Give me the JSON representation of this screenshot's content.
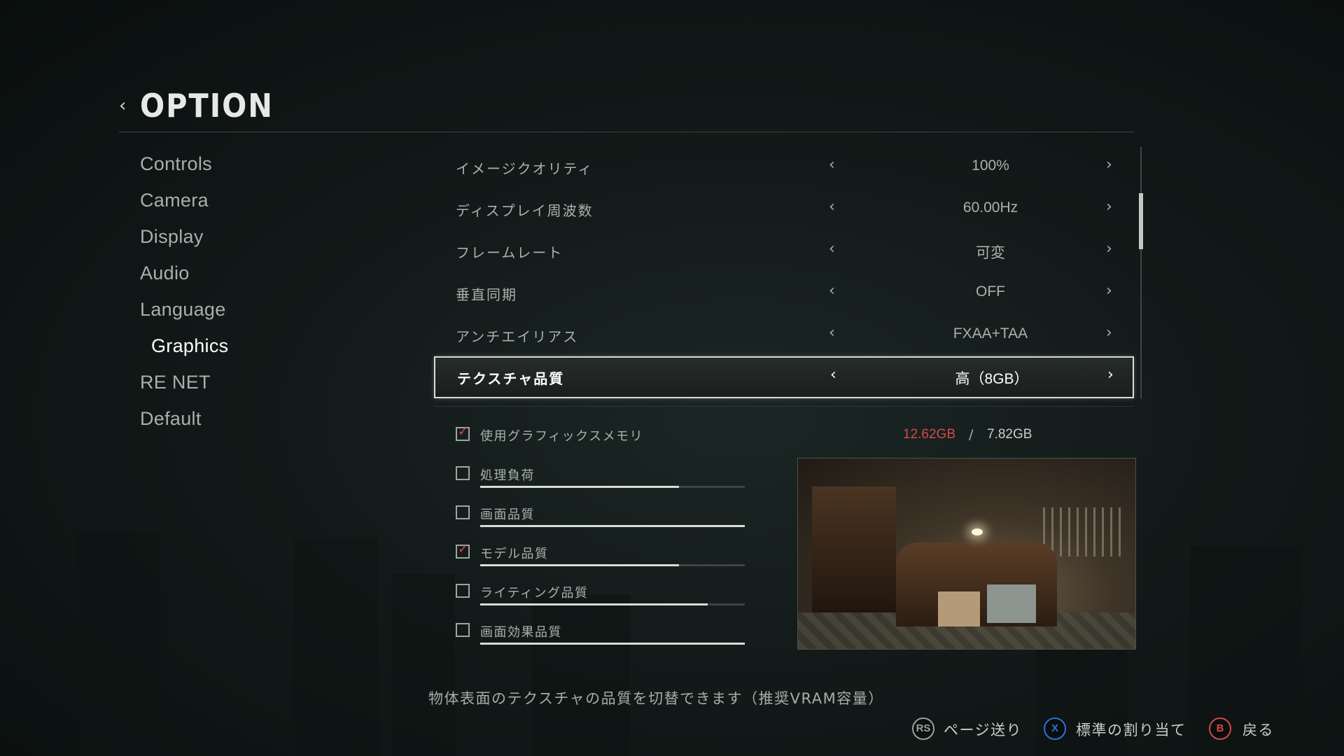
{
  "header": {
    "title": "OPTION"
  },
  "sidebar": {
    "items": [
      {
        "label": "Controls"
      },
      {
        "label": "Camera"
      },
      {
        "label": "Display"
      },
      {
        "label": "Audio"
      },
      {
        "label": "Language"
      },
      {
        "label": "Graphics",
        "active": true
      },
      {
        "label": "RE NET"
      },
      {
        "label": "Default"
      }
    ]
  },
  "settings": [
    {
      "label": "イメージクオリティ",
      "value": "100%"
    },
    {
      "label": "ディスプレイ周波数",
      "value": "60.00Hz"
    },
    {
      "label": "フレームレート",
      "value": "可変"
    },
    {
      "label": "垂直同期",
      "value": "OFF"
    },
    {
      "label": "アンチエイリアス",
      "value": "FXAA+TAA"
    },
    {
      "label": "テクスチャ品質",
      "value": "高（8GB）",
      "selected": true
    }
  ],
  "vram": {
    "label": "使用グラフィックスメモリ",
    "used": "12.62GB",
    "separator": "/",
    "total": "7.82GB",
    "checked": true
  },
  "meters": [
    {
      "label": "処理負荷",
      "checked": false,
      "level": 0.75
    },
    {
      "label": "画面品質",
      "checked": false,
      "level": 1.0
    },
    {
      "label": "モデル品質",
      "checked": true,
      "level": 0.75
    },
    {
      "label": "ライティング品質",
      "checked": false,
      "level": 0.86
    },
    {
      "label": "画面効果品質",
      "checked": false,
      "level": 1.0
    }
  ],
  "description": "物体表面のテクスチャの品質を切替できます（推奨VRAM容量）",
  "hints": [
    {
      "button": "RS",
      "label": "ページ送り",
      "color": "#9aa09d"
    },
    {
      "button": "X",
      "label": "標準の割り当て",
      "color": "#2f6fd6"
    },
    {
      "button": "B",
      "label": "戻る",
      "color": "#d24a4a"
    }
  ],
  "colors": {
    "accent_red": "#d24a4a",
    "text": "#c9cdca",
    "selected_border": "#d8dbd8"
  }
}
